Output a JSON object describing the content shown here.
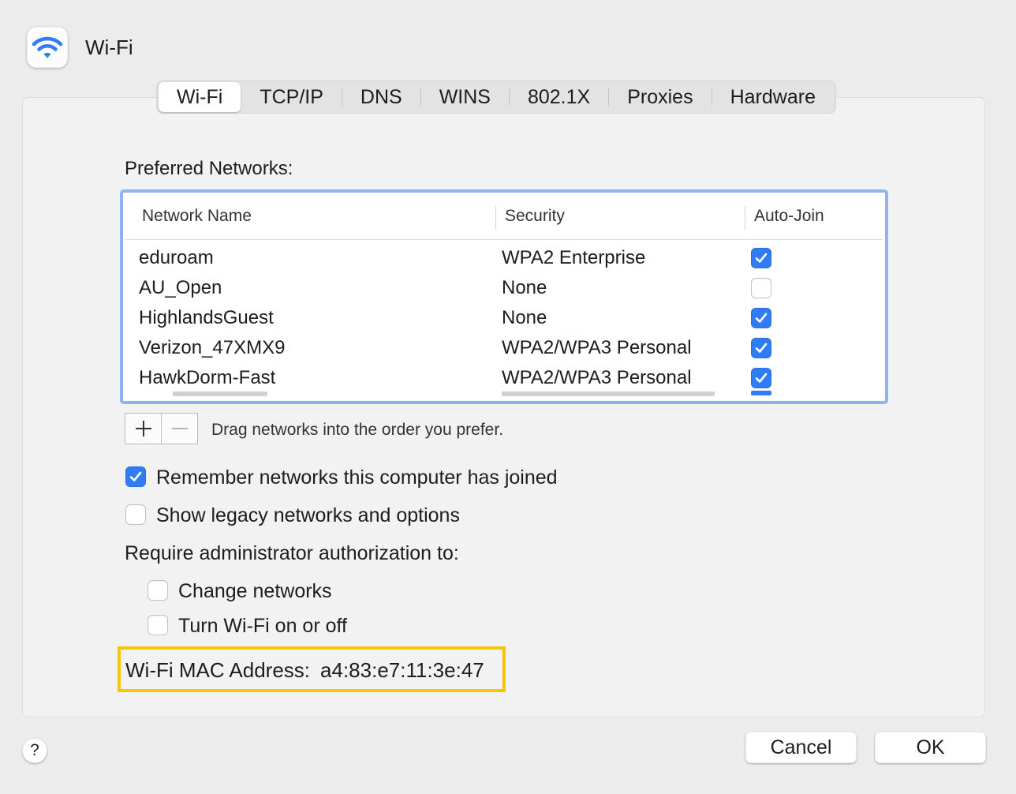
{
  "window": {
    "title": "Wi-Fi",
    "icon": "wifi-icon"
  },
  "tabs": [
    {
      "label": "Wi-Fi",
      "selected": true
    },
    {
      "label": "TCP/IP",
      "selected": false
    },
    {
      "label": "DNS",
      "selected": false
    },
    {
      "label": "WINS",
      "selected": false
    },
    {
      "label": "802.1X",
      "selected": false
    },
    {
      "label": "Proxies",
      "selected": false
    },
    {
      "label": "Hardware",
      "selected": false
    }
  ],
  "preferred": {
    "label": "Preferred Networks:",
    "columns": [
      "Network Name",
      "Security",
      "Auto-Join"
    ],
    "rows": [
      {
        "name": "eduroam",
        "security": "WPA2 Enterprise",
        "auto_join": true
      },
      {
        "name": "AU_Open",
        "security": "None",
        "auto_join": false
      },
      {
        "name": "HighlandsGuest",
        "security": "None",
        "auto_join": true
      },
      {
        "name": "Verizon_47XMX9",
        "security": "WPA2/WPA3 Personal",
        "auto_join": true
      },
      {
        "name": "HawkDorm-Fast",
        "security": "WPA2/WPA3 Personal",
        "auto_join": true
      }
    ],
    "drag_hint": "Drag networks into the order you prefer."
  },
  "options": {
    "remember": {
      "label": "Remember networks this computer has joined",
      "checked": true
    },
    "legacy": {
      "label": "Show legacy networks and options",
      "checked": false
    },
    "admin_label": "Require administrator authorization to:",
    "change_networks": {
      "label": "Change networks",
      "checked": false
    },
    "toggle_wifi": {
      "label": "Turn Wi-Fi on or off",
      "checked": false
    }
  },
  "mac": {
    "label": "Wi-Fi MAC Address:",
    "value": "a4:83:e7:11:3e:47"
  },
  "footer": {
    "help": "?",
    "cancel": "Cancel",
    "ok": "OK"
  },
  "colors": {
    "accent": "#2f7cf6",
    "highlight": "#f7c600",
    "table_focus": "#8fb3f0"
  }
}
